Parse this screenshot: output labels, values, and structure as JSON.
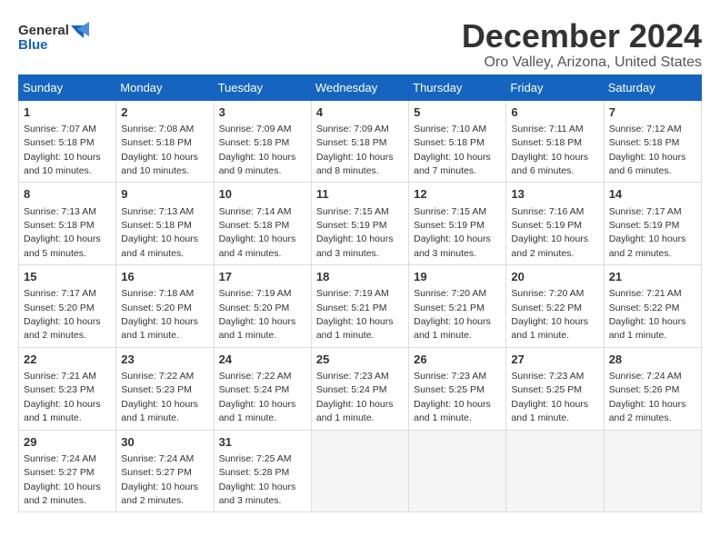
{
  "logo": {
    "general": "General",
    "blue": "Blue"
  },
  "title": "December 2024",
  "location": "Oro Valley, Arizona, United States",
  "days_header": [
    "Sunday",
    "Monday",
    "Tuesday",
    "Wednesday",
    "Thursday",
    "Friday",
    "Saturday"
  ],
  "weeks": [
    [
      {
        "day": "1",
        "sunrise": "7:07 AM",
        "sunset": "5:18 PM",
        "daylight": "10 hours and 10 minutes."
      },
      {
        "day": "2",
        "sunrise": "7:08 AM",
        "sunset": "5:18 PM",
        "daylight": "10 hours and 10 minutes."
      },
      {
        "day": "3",
        "sunrise": "7:09 AM",
        "sunset": "5:18 PM",
        "daylight": "10 hours and 9 minutes."
      },
      {
        "day": "4",
        "sunrise": "7:09 AM",
        "sunset": "5:18 PM",
        "daylight": "10 hours and 8 minutes."
      },
      {
        "day": "5",
        "sunrise": "7:10 AM",
        "sunset": "5:18 PM",
        "daylight": "10 hours and 7 minutes."
      },
      {
        "day": "6",
        "sunrise": "7:11 AM",
        "sunset": "5:18 PM",
        "daylight": "10 hours and 6 minutes."
      },
      {
        "day": "7",
        "sunrise": "7:12 AM",
        "sunset": "5:18 PM",
        "daylight": "10 hours and 6 minutes."
      }
    ],
    [
      {
        "day": "8",
        "sunrise": "7:13 AM",
        "sunset": "5:18 PM",
        "daylight": "10 hours and 5 minutes."
      },
      {
        "day": "9",
        "sunrise": "7:13 AM",
        "sunset": "5:18 PM",
        "daylight": "10 hours and 4 minutes."
      },
      {
        "day": "10",
        "sunrise": "7:14 AM",
        "sunset": "5:18 PM",
        "daylight": "10 hours and 4 minutes."
      },
      {
        "day": "11",
        "sunrise": "7:15 AM",
        "sunset": "5:19 PM",
        "daylight": "10 hours and 3 minutes."
      },
      {
        "day": "12",
        "sunrise": "7:15 AM",
        "sunset": "5:19 PM",
        "daylight": "10 hours and 3 minutes."
      },
      {
        "day": "13",
        "sunrise": "7:16 AM",
        "sunset": "5:19 PM",
        "daylight": "10 hours and 2 minutes."
      },
      {
        "day": "14",
        "sunrise": "7:17 AM",
        "sunset": "5:19 PM",
        "daylight": "10 hours and 2 minutes."
      }
    ],
    [
      {
        "day": "15",
        "sunrise": "7:17 AM",
        "sunset": "5:20 PM",
        "daylight": "10 hours and 2 minutes."
      },
      {
        "day": "16",
        "sunrise": "7:18 AM",
        "sunset": "5:20 PM",
        "daylight": "10 hours and 1 minute."
      },
      {
        "day": "17",
        "sunrise": "7:19 AM",
        "sunset": "5:20 PM",
        "daylight": "10 hours and 1 minute."
      },
      {
        "day": "18",
        "sunrise": "7:19 AM",
        "sunset": "5:21 PM",
        "daylight": "10 hours and 1 minute."
      },
      {
        "day": "19",
        "sunrise": "7:20 AM",
        "sunset": "5:21 PM",
        "daylight": "10 hours and 1 minute."
      },
      {
        "day": "20",
        "sunrise": "7:20 AM",
        "sunset": "5:22 PM",
        "daylight": "10 hours and 1 minute."
      },
      {
        "day": "21",
        "sunrise": "7:21 AM",
        "sunset": "5:22 PM",
        "daylight": "10 hours and 1 minute."
      }
    ],
    [
      {
        "day": "22",
        "sunrise": "7:21 AM",
        "sunset": "5:23 PM",
        "daylight": "10 hours and 1 minute."
      },
      {
        "day": "23",
        "sunrise": "7:22 AM",
        "sunset": "5:23 PM",
        "daylight": "10 hours and 1 minute."
      },
      {
        "day": "24",
        "sunrise": "7:22 AM",
        "sunset": "5:24 PM",
        "daylight": "10 hours and 1 minute."
      },
      {
        "day": "25",
        "sunrise": "7:23 AM",
        "sunset": "5:24 PM",
        "daylight": "10 hours and 1 minute."
      },
      {
        "day": "26",
        "sunrise": "7:23 AM",
        "sunset": "5:25 PM",
        "daylight": "10 hours and 1 minute."
      },
      {
        "day": "27",
        "sunrise": "7:23 AM",
        "sunset": "5:25 PM",
        "daylight": "10 hours and 1 minute."
      },
      {
        "day": "28",
        "sunrise": "7:24 AM",
        "sunset": "5:26 PM",
        "daylight": "10 hours and 2 minutes."
      }
    ],
    [
      {
        "day": "29",
        "sunrise": "7:24 AM",
        "sunset": "5:27 PM",
        "daylight": "10 hours and 2 minutes."
      },
      {
        "day": "30",
        "sunrise": "7:24 AM",
        "sunset": "5:27 PM",
        "daylight": "10 hours and 2 minutes."
      },
      {
        "day": "31",
        "sunrise": "7:25 AM",
        "sunset": "5:28 PM",
        "daylight": "10 hours and 3 minutes."
      },
      null,
      null,
      null,
      null
    ]
  ],
  "labels": {
    "sunrise": "Sunrise:",
    "sunset": "Sunset:",
    "daylight": "Daylight:"
  }
}
